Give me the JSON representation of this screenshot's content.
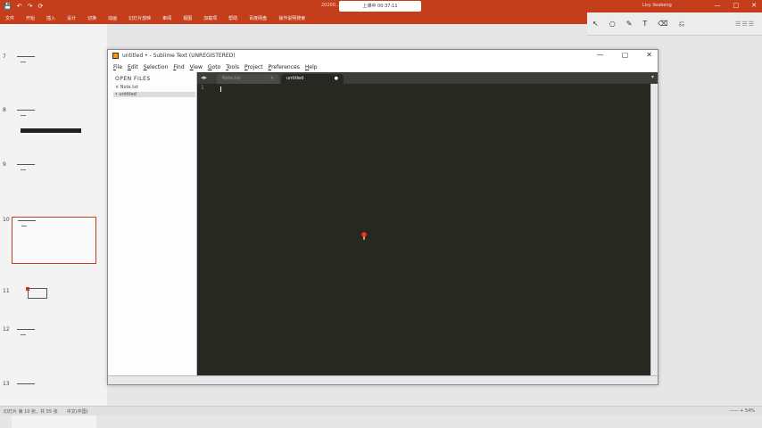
{
  "ribbon": {
    "quick_access": [
      "💾",
      "↶",
      "↷",
      "⟳"
    ],
    "doc_title": "20200...",
    "share_label": "上课中 00:37:11",
    "account": "Lisy lieabeng",
    "window_controls": [
      "—",
      "□",
      "✕"
    ],
    "tabs": [
      "文件",
      "开始",
      "插入",
      "设计",
      "切换",
      "动画",
      "幻灯片放映",
      "审阅",
      "视图",
      "加载项",
      "帮助",
      "百度网盘",
      "操作说明搜索"
    ]
  },
  "overlay": {
    "tools": [
      "↖",
      "○",
      "✎",
      "T",
      "⌫",
      "⎌"
    ],
    "logo": "☰☰☰"
  },
  "slides": [
    {
      "num": "7"
    },
    {
      "num": "8"
    },
    {
      "num": "9"
    },
    {
      "num": "10"
    },
    {
      "num": "11"
    },
    {
      "num": "12"
    },
    {
      "num": "13"
    }
  ],
  "sublime": {
    "title": "untitled • - Sublime Text (UNREGISTERED)",
    "menu": [
      "File",
      "Edit",
      "Selection",
      "Find",
      "View",
      "Goto",
      "Tools",
      "Project",
      "Preferences",
      "Help"
    ],
    "window_controls": [
      "—",
      "▢",
      "✕"
    ],
    "sidebar_heading": "OPEN FILES",
    "open_files": [
      {
        "label": "× Note.txt"
      },
      {
        "label": "• untitled"
      }
    ],
    "tabs": [
      {
        "label": "Note.txt",
        "close": "×"
      },
      {
        "label": "untitled",
        "close": "●"
      }
    ],
    "gutter_line": "1"
  },
  "status": {
    "left": [
      "幻灯片 第 10 张，共 55 张",
      "中文(中国)"
    ],
    "zoom": "—— + 54%"
  },
  "colors": {
    "ribbon": "#c43e1c",
    "editor_bg": "#272822",
    "tab_bar": "#3c3d38"
  }
}
